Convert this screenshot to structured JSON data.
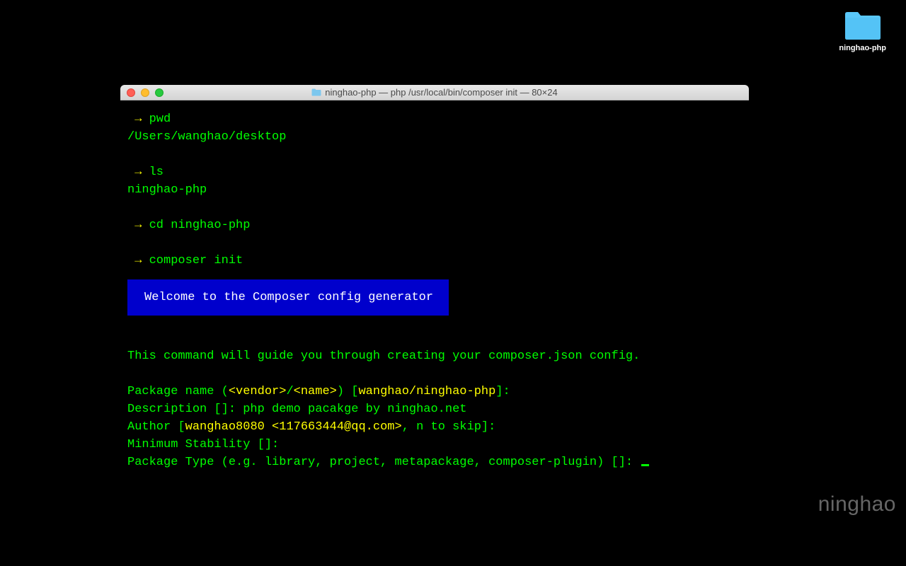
{
  "desktop": {
    "folder_label": "ninghao-php"
  },
  "window": {
    "title": "ninghao-php — php /usr/local/bin/composer init — 80×24"
  },
  "term": {
    "prompt": "→ ",
    "cmd_pwd": "pwd",
    "out_pwd": "/Users/wanghao/desktop",
    "cmd_ls": "ls",
    "out_ls": "ninghao-php",
    "cmd_cd": "cd ninghao-php",
    "cmd_composer": "composer init",
    "banner": "Welcome to the Composer config generator",
    "guide": "This command will guide you through creating your composer.json config.",
    "pkg_label": "Package name (",
    "vendor": "<vendor>",
    "slash": "/",
    "name": "<name>",
    "pkg_close": ") [",
    "pkg_default": "wanghao/ninghao-php",
    "bracket_end": "]:",
    "desc_label": "Description []: ",
    "desc_val": "php demo pacakge by ninghao.net",
    "author_label": "Author [",
    "author_val": "wanghao8080 <117663444@qq.com>",
    "author_rest": ", n to skip]:",
    "minstab": "Minimum Stability []:",
    "pkgtype": "Package Type (e.g. library, project, metapackage, composer-plugin) []: "
  },
  "watermark": "ninghao"
}
